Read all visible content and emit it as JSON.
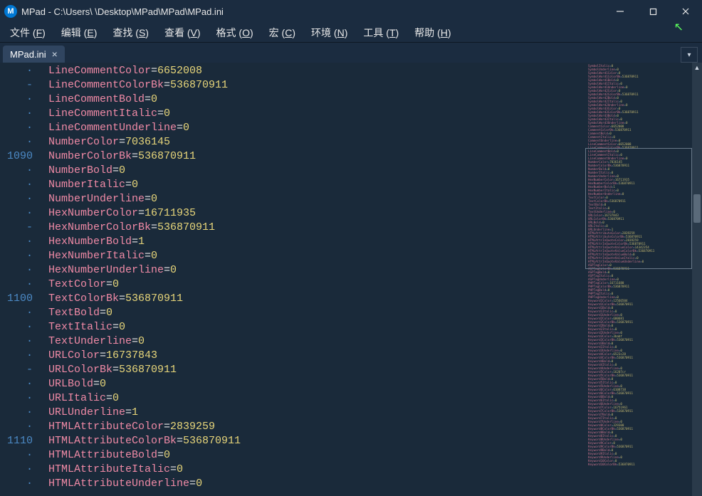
{
  "titlebar": {
    "icon_letter": "M",
    "text": "MPad - C:\\Users\\   \\Desktop\\MPad\\MPad\\MPad.ini"
  },
  "menu": [
    {
      "label": "文件",
      "key": "F"
    },
    {
      "label": "编辑",
      "key": "E"
    },
    {
      "label": "查找",
      "key": "S"
    },
    {
      "label": "查看",
      "key": "V"
    },
    {
      "label": "格式",
      "key": "O"
    },
    {
      "label": "宏",
      "key": "C"
    },
    {
      "label": "环境",
      "key": "N"
    },
    {
      "label": "工具",
      "key": "T"
    },
    {
      "label": "帮助",
      "key": "H"
    }
  ],
  "tab": {
    "label": "MPad.ini"
  },
  "gutter_lines": [
    "·",
    "-",
    "·",
    "·",
    "·",
    "·",
    "1090",
    "·",
    "·",
    "·",
    "·",
    "-",
    "·",
    "·",
    "·",
    "·",
    "1100",
    "·",
    "·",
    "·",
    "·",
    "-",
    "·",
    "·",
    "·",
    "·",
    "1110",
    "·",
    "·",
    "·"
  ],
  "code_lines": [
    {
      "key": "LineCommentColor",
      "val": "6652008"
    },
    {
      "key": "LineCommentColorBk",
      "val": "536870911"
    },
    {
      "key": "LineCommentBold",
      "val": "0"
    },
    {
      "key": "LineCommentItalic",
      "val": "0"
    },
    {
      "key": "LineCommentUnderline",
      "val": "0"
    },
    {
      "key": "NumberColor",
      "val": "7036145"
    },
    {
      "key": "NumberColorBk",
      "val": "536870911"
    },
    {
      "key": "NumberBold",
      "val": "0"
    },
    {
      "key": "NumberItalic",
      "val": "0"
    },
    {
      "key": "NumberUnderline",
      "val": "0"
    },
    {
      "key": "HexNumberColor",
      "val": "16711935"
    },
    {
      "key": "HexNumberColorBk",
      "val": "536870911"
    },
    {
      "key": "HexNumberBold",
      "val": "1"
    },
    {
      "key": "HexNumberItalic",
      "val": "0"
    },
    {
      "key": "HexNumberUnderline",
      "val": "0"
    },
    {
      "key": "TextColor",
      "val": "0"
    },
    {
      "key": "TextColorBk",
      "val": "536870911"
    },
    {
      "key": "TextBold",
      "val": "0"
    },
    {
      "key": "TextItalic",
      "val": "0"
    },
    {
      "key": "TextUnderline",
      "val": "0"
    },
    {
      "key": "URLColor",
      "val": "16737843"
    },
    {
      "key": "URLColorBk",
      "val": "536870911"
    },
    {
      "key": "URLBold",
      "val": "0"
    },
    {
      "key": "URLItalic",
      "val": "0"
    },
    {
      "key": "URLUnderline",
      "val": "1"
    },
    {
      "key": "HTMLAttributeColor",
      "val": "2839259"
    },
    {
      "key": "HTMLAttributeColorBk",
      "val": "536870911"
    },
    {
      "key": "HTMLAttributeBold",
      "val": "0"
    },
    {
      "key": "HTMLAttributeItalic",
      "val": "0"
    },
    {
      "key": "HTMLAttributeUnderline",
      "val": "0"
    }
  ],
  "minimap_lines": [
    {
      "k": "SymbolItalic",
      "v": "0"
    },
    {
      "k": "SymbolUnderline",
      "v": "0"
    },
    {
      "k": "SymbolWord1Color",
      "v": "0"
    },
    {
      "k": "SymbolWord1ColorBk",
      "v": "536870911"
    },
    {
      "k": "SymbolWord1Bold",
      "v": "0"
    },
    {
      "k": "SymbolWord1Italic",
      "v": "0"
    },
    {
      "k": "SymbolWord1Underline",
      "v": "0"
    },
    {
      "k": "SymbolWord2Color",
      "v": "0"
    },
    {
      "k": "SymbolWord2ColorBk",
      "v": "536870911"
    },
    {
      "k": "SymbolWord2Bold",
      "v": "0"
    },
    {
      "k": "SymbolWord2Italic",
      "v": "0"
    },
    {
      "k": "SymbolWord2Underline",
      "v": "0"
    },
    {
      "k": "SymbolWord3Color",
      "v": "0"
    },
    {
      "k": "SymbolWord3ColorBk",
      "v": "536870911"
    },
    {
      "k": "SymbolWord3Bold",
      "v": "0"
    },
    {
      "k": "SymbolWord3Italic",
      "v": "0"
    },
    {
      "k": "SymbolWord3Underline",
      "v": "0"
    },
    {
      "k": "CommentColor",
      "v": "6652008"
    },
    {
      "k": "CommentColorBk",
      "v": "536870911"
    },
    {
      "k": "CommentBold",
      "v": "0"
    },
    {
      "k": "CommentItalic",
      "v": "0"
    },
    {
      "k": "CommentUnderline",
      "v": "0"
    },
    {
      "k": "LineCommentColor",
      "v": "6652008"
    },
    {
      "k": "LineCommentColorBk",
      "v": "536870911"
    },
    {
      "k": "LineCommentBold",
      "v": "0"
    },
    {
      "k": "LineCommentItalic",
      "v": "0"
    },
    {
      "k": "LineCommentUnderline",
      "v": "0"
    },
    {
      "k": "NumberColor",
      "v": "7036145"
    },
    {
      "k": "NumberColorBk",
      "v": "536870911"
    },
    {
      "k": "NumberBold",
      "v": "0"
    },
    {
      "k": "NumberItalic",
      "v": "0"
    },
    {
      "k": "NumberUnderline",
      "v": "0"
    },
    {
      "k": "HexNumberColor",
      "v": "16711935"
    },
    {
      "k": "HexNumberColorBk",
      "v": "536870911"
    },
    {
      "k": "HexNumberBold",
      "v": "1"
    },
    {
      "k": "HexNumberItalic",
      "v": "0"
    },
    {
      "k": "HexNumberUnderline",
      "v": "0"
    },
    {
      "k": "TextColor",
      "v": "0"
    },
    {
      "k": "TextColorBk",
      "v": "536870911"
    },
    {
      "k": "TextBold",
      "v": "0"
    },
    {
      "k": "TextItalic",
      "v": "0"
    },
    {
      "k": "TextUnderline",
      "v": "0"
    },
    {
      "k": "URLColor",
      "v": "16737843"
    },
    {
      "k": "URLColorBk",
      "v": "536870911"
    },
    {
      "k": "URLBold",
      "v": "0"
    },
    {
      "k": "URLItalic",
      "v": "0"
    },
    {
      "k": "URLUnderline",
      "v": "1"
    },
    {
      "k": "HTMLAttributeColor",
      "v": "2839259"
    },
    {
      "k": "HTMLAttributeColorBk",
      "v": "536870911"
    },
    {
      "k": "HTMLAttrInQuoteColor",
      "v": "2839259"
    },
    {
      "k": "HTMLAttrInQuoteColorBk",
      "v": "536870911"
    },
    {
      "k": "HTMLAttrInQuoteValueColor",
      "v": "14342354"
    },
    {
      "k": "HTMLAttrInQuoteValueColorBk",
      "v": "536870911"
    },
    {
      "k": "HTMLAttrInQuoteValueBold",
      "v": "0"
    },
    {
      "k": "HTMLAttrInQuoteValueItalic",
      "v": "0"
    },
    {
      "k": "HTMLAttrInQuoteValueUnderline",
      "v": "0"
    },
    {
      "k": "ASPTagColor",
      "v": "0"
    },
    {
      "k": "ASPTagColorBk",
      "v": "536870911"
    },
    {
      "k": "ASPTagBold",
      "v": "0"
    },
    {
      "k": "ASPTagItalic",
      "v": "0"
    },
    {
      "k": "ASPTagUnderline",
      "v": "0"
    },
    {
      "k": "PHPTagColor",
      "v": "16711680"
    },
    {
      "k": "PHPTagColorBk",
      "v": "536870911"
    },
    {
      "k": "PHPTagBold",
      "v": "0"
    },
    {
      "k": "PHPTagItalic",
      "v": "0"
    },
    {
      "k": "PHPTagUnderline",
      "v": "0"
    },
    {
      "k": "Keyword1Color",
      "v": "12566504"
    },
    {
      "k": "Keyword1ColorBk",
      "v": "536870911"
    },
    {
      "k": "Keyword1Bold",
      "v": "0"
    },
    {
      "k": "Keyword1Italic",
      "v": "0"
    },
    {
      "k": "Keyword1Underline",
      "v": "0"
    },
    {
      "k": "Keyword2Color",
      "v": "680681"
    },
    {
      "k": "Keyword2ColorBk",
      "v": "536870911"
    },
    {
      "k": "Keyword2Bold",
      "v": "0"
    },
    {
      "k": "Keyword2Italic",
      "v": "0"
    },
    {
      "k": "Keyword2Underline",
      "v": "0"
    },
    {
      "k": "Keyword3Color",
      "v": "3babf"
    },
    {
      "k": "Keyword3ColorBk",
      "v": "536870911"
    },
    {
      "k": "Keyword3Bold",
      "v": "0"
    },
    {
      "k": "Keyword3Italic",
      "v": "0"
    },
    {
      "k": "Keyword3Underline",
      "v": "0"
    },
    {
      "k": "Keyword4Color",
      "v": "6523c28"
    },
    {
      "k": "Keyword4ColorBk",
      "v": "536870911"
    },
    {
      "k": "Keyword4Bold",
      "v": "0"
    },
    {
      "k": "Keyword4Italic",
      "v": "0"
    },
    {
      "k": "Keyword4Underline",
      "v": "0"
    },
    {
      "k": "Keyword5Color",
      "v": "16207cr"
    },
    {
      "k": "Keyword5ColorBk",
      "v": "536870911"
    },
    {
      "k": "Keyword5Bold",
      "v": "0"
    },
    {
      "k": "Keyword5Italic",
      "v": "0"
    },
    {
      "k": "Keyword5Underline",
      "v": "0"
    },
    {
      "k": "Keyword6Color",
      "v": "6108738"
    },
    {
      "k": "Keyword6ColorBk",
      "v": "536870911"
    },
    {
      "k": "Keyword6Bold",
      "v": "0"
    },
    {
      "k": "Keyword6Italic",
      "v": "0"
    },
    {
      "k": "Keyword6Underline",
      "v": "0"
    },
    {
      "k": "Keyword7Color",
      "v": "16751961"
    },
    {
      "k": "Keyword7ColorBk",
      "v": "536870911"
    },
    {
      "k": "Keyword7Bold",
      "v": "0"
    },
    {
      "k": "Keyword7Italic",
      "v": "0"
    },
    {
      "k": "Keyword7Underline",
      "v": "0"
    },
    {
      "k": "Keyword8Color",
      "v": "329300"
    },
    {
      "k": "Keyword8ColorBk",
      "v": "536870911"
    },
    {
      "k": "Keyword8Bold",
      "v": "0"
    },
    {
      "k": "Keyword8Italic",
      "v": "0"
    },
    {
      "k": "Keyword8Underline",
      "v": "0"
    },
    {
      "k": "Keyword9Color",
      "v": "0"
    },
    {
      "k": "Keyword9ColorBk",
      "v": "536870911"
    },
    {
      "k": "Keyword9Bold",
      "v": "0"
    },
    {
      "k": "Keyword9Italic",
      "v": "0"
    },
    {
      "k": "Keyword9Underline",
      "v": "0"
    },
    {
      "k": "Keyword10Color",
      "v": "0"
    },
    {
      "k": "Keyword10ColorBk",
      "v": "536870911"
    }
  ]
}
